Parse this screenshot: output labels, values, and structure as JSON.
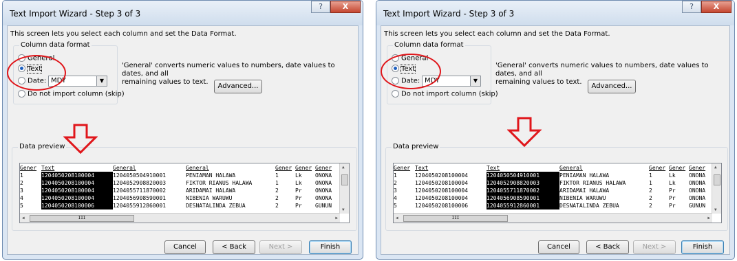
{
  "dialogs": [
    {
      "title": "Text Import Wizard - Step 3 of 3",
      "help_glyph": "?",
      "close_glyph": "X",
      "description": "This screen lets you select each column and set the Data Format.",
      "column_format": {
        "legend": "Column data format",
        "general": "General",
        "text": "Text",
        "date": "Date:",
        "date_value": "MDY",
        "skip": "Do not import column (skip)",
        "selected": "Text"
      },
      "info_line1": "'General' converts numeric values to numbers, date values to dates, and all",
      "info_line2": "remaining values to text.",
      "advanced_label": "Advanced...",
      "preview_label": "Data preview",
      "preview_headers": [
        "Gener",
        "Text",
        "General",
        "General",
        "Gener",
        "Gener",
        "Gener"
      ],
      "preview_rows": [
        [
          "1",
          "1204050208100004",
          "1204050504910001",
          "PENIAMAN HALAWA",
          "1",
          "Lk",
          "ONONA"
        ],
        [
          "2",
          "1204050208100004",
          "1204052908820003",
          "FIKTOR RIANUS HALAWA",
          "1",
          "Lk",
          "ONONA"
        ],
        [
          "3",
          "1204050208100004",
          "1204055711870002",
          "ARIDAMAI HALAWA",
          "2",
          "Pr",
          "ONONA"
        ],
        [
          "4",
          "1204050208100004",
          "1204056908590001",
          "NIBENIA WARUWU",
          "2",
          "Pr",
          "ONONA"
        ],
        [
          "5",
          "1204050208100006",
          "1204055912860001",
          "DESNATALINDA ZEBUA",
          "2",
          "Pr",
          "GUNUN"
        ]
      ],
      "selected_column": 1,
      "scroll_thumb": "III",
      "buttons": {
        "cancel": "Cancel",
        "back": "< Back",
        "next": "Next >",
        "finish": "Finish"
      }
    },
    {
      "title": "Text Import Wizard - Step 3 of 3",
      "help_glyph": "?",
      "close_glyph": "X",
      "description": "This screen lets you select each column and set the Data Format.",
      "column_format": {
        "legend": "Column data format",
        "general": "General",
        "text": "Text",
        "date": "Date:",
        "date_value": "MDY",
        "skip": "Do not import column (skip)",
        "selected": "Text"
      },
      "info_line1": "'General' converts numeric values to numbers, date values to dates, and all",
      "info_line2": "remaining values to text.",
      "advanced_label": "Advanced...",
      "preview_label": "Data preview",
      "preview_headers": [
        "Gener",
        "Text",
        "Text",
        "General",
        "Gener",
        "Gener",
        "Gener"
      ],
      "preview_rows": [
        [
          "1",
          "1204050208100004",
          "1204050504910001",
          "PENIAMAN HALAWA",
          "1",
          "Lk",
          "ONONA"
        ],
        [
          "2",
          "1204050208100004",
          "1204052908820003",
          "FIKTOR RIANUS HALAWA",
          "1",
          "Lk",
          "ONONA"
        ],
        [
          "3",
          "1204050208100004",
          "1204055711870002",
          "ARIDAMAI HALAWA",
          "2",
          "Pr",
          "ONONA"
        ],
        [
          "4",
          "1204050208100004",
          "1204056908590001",
          "NIBENIA WARUWU",
          "2",
          "Pr",
          "ONONA"
        ],
        [
          "5",
          "1204050208100006",
          "1204055912860001",
          "DESNATALINDA ZEBUA",
          "2",
          "Pr",
          "GUNUN"
        ]
      ],
      "selected_column": 2,
      "scroll_thumb": "III",
      "buttons": {
        "cancel": "Cancel",
        "back": "< Back",
        "next": "Next >",
        "finish": "Finish"
      }
    }
  ],
  "annotation_color": "#e0161b"
}
